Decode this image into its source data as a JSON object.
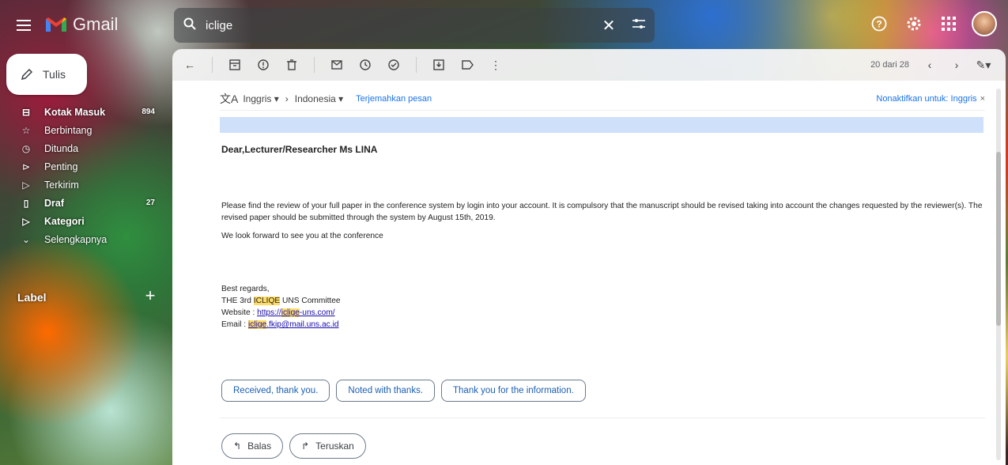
{
  "app": {
    "name": "Gmail"
  },
  "search": {
    "value": "iclige"
  },
  "compose": {
    "label": "Tulis"
  },
  "sidebar": {
    "items": [
      {
        "label": "Kotak Masuk",
        "count": "894",
        "icon": "inbox-icon"
      },
      {
        "label": "Berbintang",
        "count": "",
        "icon": "star-icon"
      },
      {
        "label": "Ditunda",
        "count": "",
        "icon": "clock-icon"
      },
      {
        "label": "Penting",
        "count": "",
        "icon": "important-icon"
      },
      {
        "label": "Terkirim",
        "count": "",
        "icon": "send-icon"
      },
      {
        "label": "Draf",
        "count": "27",
        "icon": "draft-icon"
      },
      {
        "label": "Kategori",
        "count": "",
        "icon": "label-icon"
      },
      {
        "label": "Selengkapnya",
        "count": "",
        "icon": "chevron-down-icon"
      }
    ],
    "label_heading": "Label"
  },
  "toolbar": {
    "pager": "20 dari 28"
  },
  "translate": {
    "from": "Inggris",
    "to": "Indonesia",
    "translate_link": "Terjemahkan pesan",
    "disable": "Nonaktifkan untuk: Inggris"
  },
  "message": {
    "greeting": "Dear,Lecturer/Researcher Ms LINA",
    "para1": "Please find the review of your full paper in the conference system by login into your account. It is compulsory that the manuscript should be revised taking into account the changes requested by the reviewer(s). The revised paper should be submitted through the system by August 15th, 2019.",
    "para2": "We look forward to see you at the conference",
    "regards": "Best regards,",
    "sig_prefix": "THE 3rd ",
    "sig_hl": "ICLIQE",
    "sig_suffix": " UNS Committee",
    "website_label": "Website : ",
    "website_pre": "https://",
    "website_hl": "iclige",
    "website_post": "-uns.com/",
    "email_label": "Email : ",
    "email_hl": "iclige",
    "email_post": ".fkip@mail.uns.ac.id"
  },
  "smart_replies": [
    "Received, thank you.",
    "Noted with thanks.",
    "Thank you for the information."
  ],
  "actions": {
    "reply": "Balas",
    "forward": "Teruskan"
  }
}
